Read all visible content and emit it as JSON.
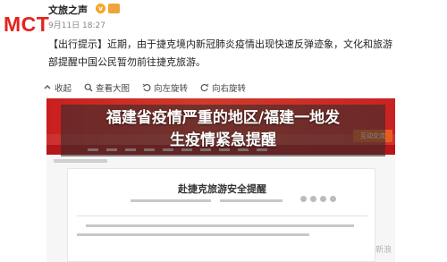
{
  "post": {
    "logo_text": "MCT",
    "author": "文旅之声",
    "verified_glyph": "v",
    "timestamp": "9月11日 18:27",
    "text_line1": "【出行提示】近期，由于捷克境内新冠肺炎疫情出现快速反弹迹象，文化和旅游",
    "text_line2": "部提醒中国公民暂勿前往捷克旅游。"
  },
  "toolbar": {
    "collapse": "收起",
    "view_large": "查看大图",
    "rotate_left": "向左旋转",
    "rotate_right": "向右旋转"
  },
  "image": {
    "doc_title": "赴捷克旅游安全提醒",
    "nav_button": "互动交流"
  },
  "headline": {
    "line1": "福建省疫情严重的地区/福建一地发",
    "line2": "生疫情紧急提醒"
  },
  "watermark": "新浪",
  "colors": {
    "logo_red": "#e5231d",
    "banner_red": "#c91f1f"
  }
}
